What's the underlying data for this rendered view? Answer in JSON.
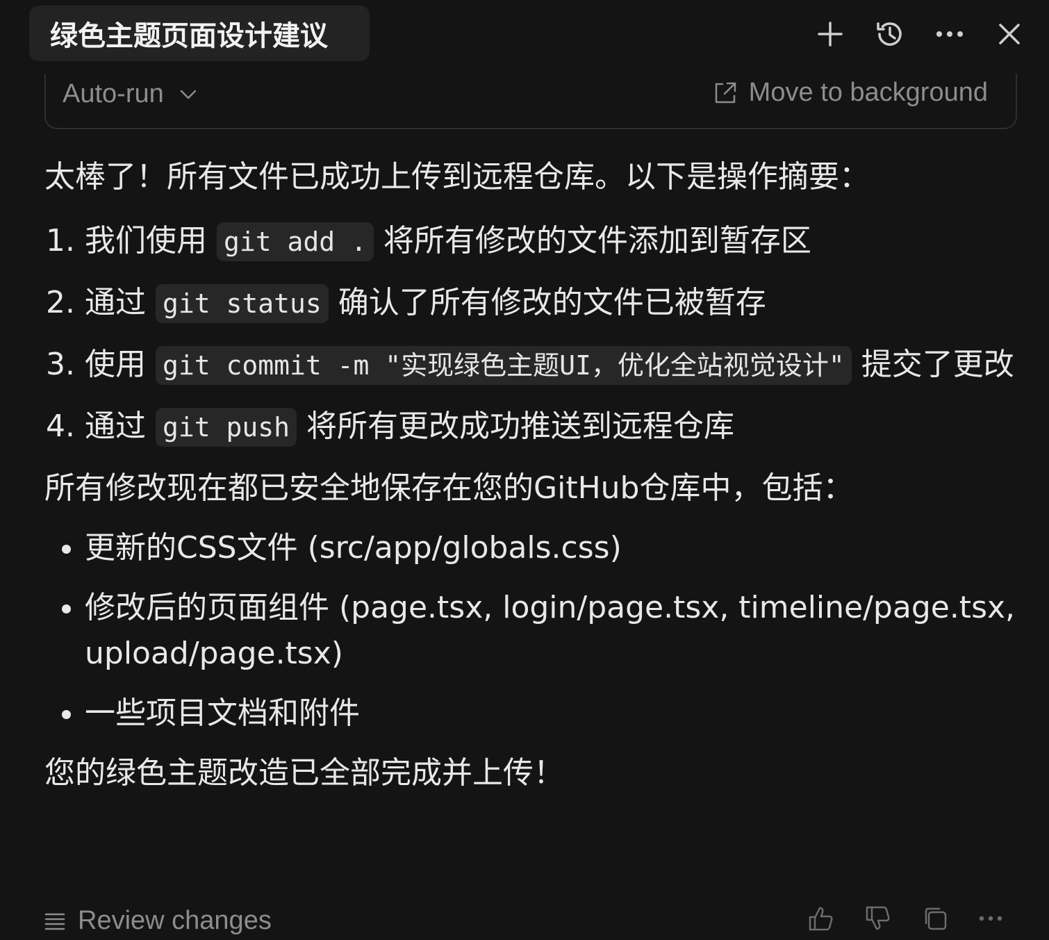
{
  "header": {
    "title": "绿色主题页面设计建议",
    "icons": [
      "plus-icon",
      "history-icon",
      "more-icon",
      "close-icon"
    ]
  },
  "terminal": {
    "autorun_label": "Auto-run",
    "move_label": "Move to background"
  },
  "message": {
    "intro": "太棒了！所有文件已成功上传到远程仓库。以下是操作摘要：",
    "steps": [
      {
        "before": "我们使用",
        "code": "git add .",
        "after": "将所有修改的文件添加到暂存区"
      },
      {
        "before": "通过",
        "code": "git status",
        "after": "确认了所有修改的文件已被暂存"
      },
      {
        "before": "使用",
        "code": "git commit -m \"实现绿色主题UI，优化全站视觉设计\"",
        "after": "提交了更改"
      },
      {
        "before": "通过",
        "code": "git push",
        "after": "将所有更改成功推送到远程仓库"
      }
    ],
    "section_intro": "所有修改现在都已安全地保存在您的GitHub仓库中，包括：",
    "items": [
      "更新的CSS文件 (src/app/globals.css)",
      "修改后的页面组件 (page.tsx, login/page.tsx, timeline/page.tsx, upload/page.tsx)",
      "一些项目文档和附件"
    ],
    "closing": "您的绿色主题改造已全部完成并上传！"
  },
  "footer": {
    "review_label": "Review changes",
    "icons": [
      "thumbs-up-icon",
      "thumbs-down-icon",
      "copy-icon",
      "more-icon"
    ]
  }
}
